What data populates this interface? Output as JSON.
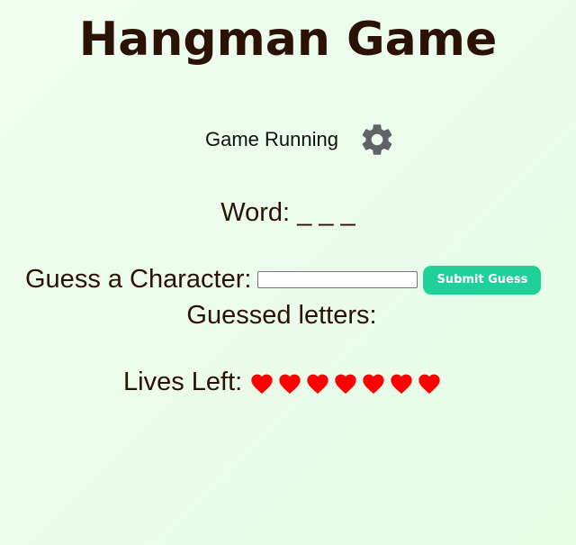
{
  "title": "Hangman Game",
  "status": {
    "text": "Game Running",
    "settings_icon": "gear-icon"
  },
  "word": {
    "label": "Word:",
    "display": "_ _ _"
  },
  "guess": {
    "label": "Guess a Character:",
    "input_value": "",
    "submit_label": "Submit Guess"
  },
  "guessed": {
    "label": "Guessed letters:",
    "letters": ""
  },
  "lives": {
    "label": "Lives Left:",
    "count": 7,
    "icon": "heart-icon",
    "color": "#ff0000"
  },
  "colors": {
    "text": "#2b1204",
    "button": "#1ed198",
    "gear": "#5f6368"
  }
}
